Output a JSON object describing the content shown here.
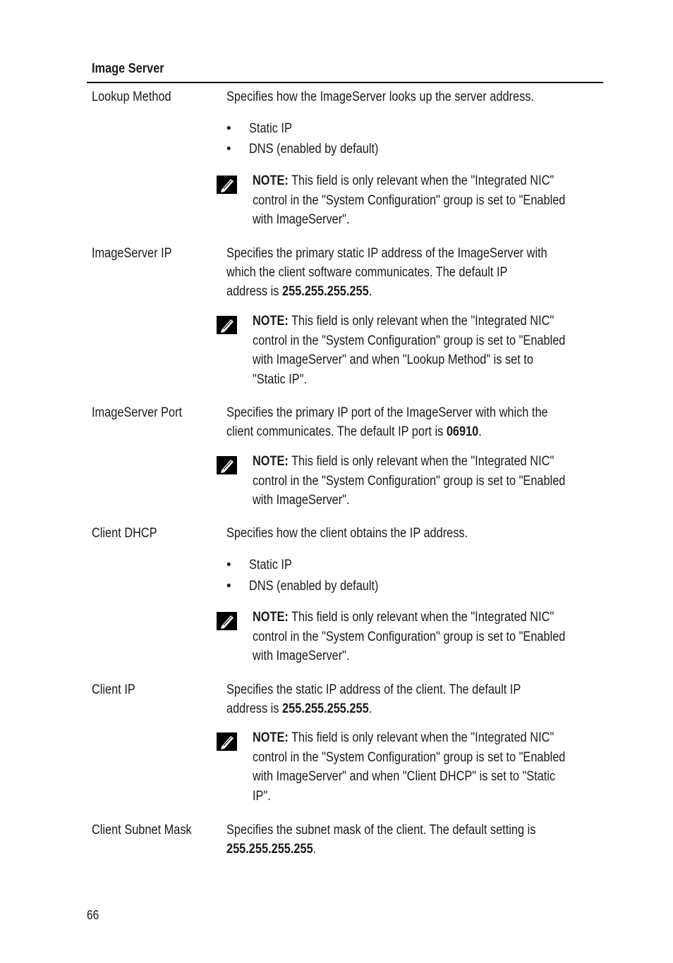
{
  "section_title": "Image Server",
  "page_number": "66",
  "note_label": "NOTE:",
  "rows": [
    {
      "label": "Lookup Method",
      "description_lines": [
        "Specifies how the ImageServer looks up the server address."
      ],
      "bullets": [
        "Static IP",
        "DNS (enabled by default)"
      ],
      "note_lines": [
        " This field is only relevant when the \"Integrated NIC\"",
        "control in the \"System Configuration\" group is set to \"Enabled",
        "with ImageServer\"."
      ]
    },
    {
      "label": "ImageServer IP",
      "description_lines": [
        "Specifies the primary static IP address of the ImageServer with",
        "which the client software communicates. The default IP",
        "address is "
      ],
      "default_value": "255.255.255.255",
      "note_lines": [
        " This field is only relevant when the \"Integrated NIC\"",
        "control in the \"System Configuration\" group is set to \"Enabled",
        "with ImageServer\" and when \"Lookup Method\" is set to",
        "\"Static IP\"."
      ]
    },
    {
      "label": "ImageServer Port",
      "description_lines": [
        "Specifies the primary IP port of the ImageServer with which the",
        "client communicates. The default IP port is "
      ],
      "default_value": "06910",
      "note_lines": [
        " This field is only relevant when the \"Integrated NIC\"",
        "control in the \"System Configuration\" group is set to \"Enabled",
        "with ImageServer\"."
      ]
    },
    {
      "label": "Client DHCP",
      "description_lines": [
        "Specifies how the client obtains the IP address."
      ],
      "bullets": [
        "Static IP",
        "DNS (enabled by default)"
      ],
      "note_lines": [
        " This field is only relevant when the \"Integrated NIC\"",
        "control in the \"System Configuration\" group is set to \"Enabled",
        "with ImageServer\"."
      ]
    },
    {
      "label": "Client IP",
      "description_lines": [
        "Specifies the static IP address of the client. The default IP",
        "address is "
      ],
      "default_value": "255.255.255.255",
      "note_lines": [
        " This field is only relevant when the \"Integrated NIC\"",
        "control in the \"System Configuration\" group is set to \"Enabled",
        "with ImageServer\" and when \"Client DHCP\" is set to \"Static",
        "IP\"."
      ]
    },
    {
      "label": "Client Subnet Mask",
      "description_lines": [
        "Specifies the subnet mask of the client. The default setting is",
        ""
      ],
      "default_value": "255.255.255.255"
    }
  ]
}
